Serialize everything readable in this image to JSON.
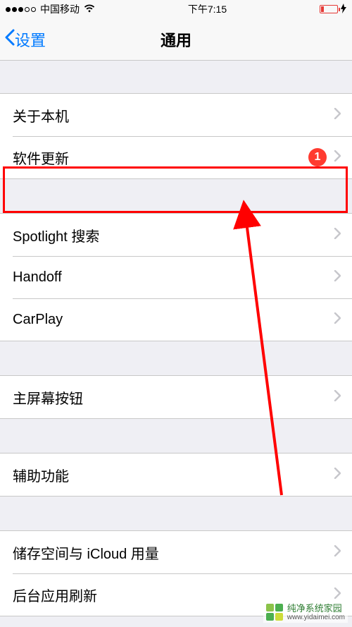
{
  "statusbar": {
    "carrier": "中国移动",
    "time": "下午7:15"
  },
  "navbar": {
    "back_label": "设置",
    "title": "通用"
  },
  "groups": [
    {
      "rows": [
        {
          "label": "关于本机",
          "badge": null
        },
        {
          "label": "软件更新",
          "badge": "1"
        }
      ]
    },
    {
      "rows": [
        {
          "label": "Spotlight 搜索",
          "badge": null
        },
        {
          "label": "Handoff",
          "badge": null
        },
        {
          "label": "CarPlay",
          "badge": null
        }
      ]
    },
    {
      "rows": [
        {
          "label": "主屏幕按钮",
          "badge": null
        }
      ]
    },
    {
      "rows": [
        {
          "label": "辅助功能",
          "badge": null
        }
      ]
    },
    {
      "rows": [
        {
          "label": "储存空间与 iCloud 用量",
          "badge": null
        },
        {
          "label": "后台应用刷新",
          "badge": null
        }
      ]
    }
  ],
  "annotation": {
    "highlight_row": "软件更新",
    "badge_value": "1",
    "color": "#ff0000"
  },
  "watermark": {
    "text": "纯净系统家园",
    "url": "www.yidaimei.com"
  }
}
